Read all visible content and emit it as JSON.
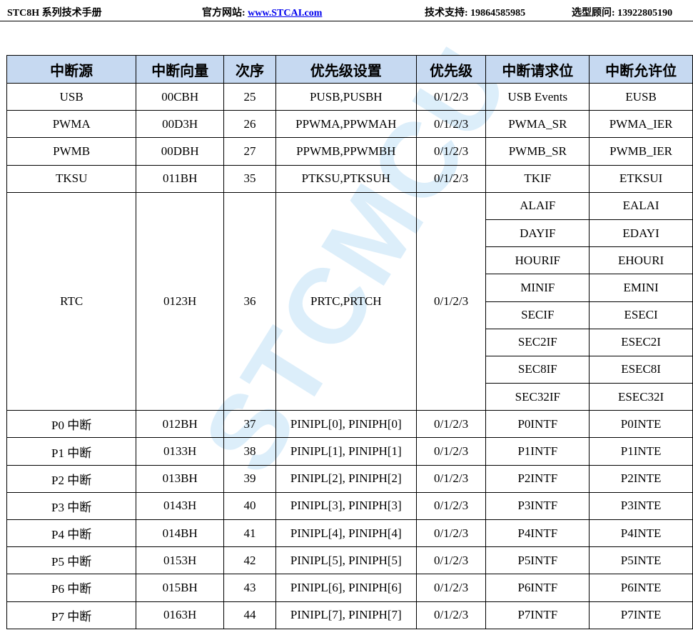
{
  "header": {
    "manual": "STC8H 系列技术手册",
    "site_label": "官方网站: ",
    "site_url": "www.STCAI.com",
    "support": "技术支持: 19864585985",
    "advisor": "选型顾问: 13922805190"
  },
  "watermark": "STCMCU",
  "table": {
    "headers": [
      "中断源",
      "中断向量",
      "次序",
      "优先级设置",
      "优先级",
      "中断请求位",
      "中断允许位"
    ],
    "rows": [
      {
        "src": "USB",
        "vec": "00CBH",
        "ord": "25",
        "set": "PUSB,PUSBH",
        "pri": "0/1/2/3",
        "req": "USB Events",
        "en": "EUSB"
      },
      {
        "src": "PWMA",
        "vec": "00D3H",
        "ord": "26",
        "set": "PPWMA,PPWMAH",
        "pri": "0/1/2/3",
        "req": "PWMA_SR",
        "en": "PWMA_IER"
      },
      {
        "src": "PWMB",
        "vec": "00DBH",
        "ord": "27",
        "set": "PPWMB,PPWMBH",
        "pri": "0/1/2/3",
        "req": "PWMB_SR",
        "en": "PWMB_IER"
      },
      {
        "src": "TKSU",
        "vec": "011BH",
        "ord": "35",
        "set": "PTKSU,PTKSUH",
        "pri": "0/1/2/3",
        "req": "TKIF",
        "en": "ETKSUI"
      }
    ],
    "rtc": {
      "src": "RTC",
      "vec": "0123H",
      "ord": "36",
      "set": "PRTC,PRTCH",
      "pri": "0/1/2/3",
      "flags": [
        {
          "req": "ALAIF",
          "en": "EALAI"
        },
        {
          "req": "DAYIF",
          "en": "EDAYI"
        },
        {
          "req": "HOURIF",
          "en": "EHOURI"
        },
        {
          "req": "MINIF",
          "en": "EMINI"
        },
        {
          "req": "SECIF",
          "en": "ESECI"
        },
        {
          "req": "SEC2IF",
          "en": "ESEC2I"
        },
        {
          "req": "SEC8IF",
          "en": "ESEC8I"
        },
        {
          "req": "SEC32IF",
          "en": "ESEC32I"
        }
      ]
    },
    "port_rows": [
      {
        "src": "P0 中断",
        "vec": "012BH",
        "ord": "37",
        "set": "PINIPL[0], PINIPH[0]",
        "pri": "0/1/2/3",
        "req": "P0INTF",
        "en": "P0INTE"
      },
      {
        "src": "P1 中断",
        "vec": "0133H",
        "ord": "38",
        "set": "PINIPL[1], PINIPH[1]",
        "pri": "0/1/2/3",
        "req": "P1INTF",
        "en": "P1INTE"
      },
      {
        "src": "P2 中断",
        "vec": "013BH",
        "ord": "39",
        "set": "PINIPL[2], PINIPH[2]",
        "pri": "0/1/2/3",
        "req": "P2INTF",
        "en": "P2INTE"
      },
      {
        "src": "P3 中断",
        "vec": "0143H",
        "ord": "40",
        "set": "PINIPL[3], PINIPH[3]",
        "pri": "0/1/2/3",
        "req": "P3INTF",
        "en": "P3INTE"
      },
      {
        "src": "P4 中断",
        "vec": "014BH",
        "ord": "41",
        "set": "PINIPL[4], PINIPH[4]",
        "pri": "0/1/2/3",
        "req": "P4INTF",
        "en": "P4INTE"
      },
      {
        "src": "P5 中断",
        "vec": "0153H",
        "ord": "42",
        "set": "PINIPL[5], PINIPH[5]",
        "pri": "0/1/2/3",
        "req": "P5INTF",
        "en": "P5INTE"
      },
      {
        "src": "P6 中断",
        "vec": "015BH",
        "ord": "43",
        "set": "PINIPL[6], PINIPH[6]",
        "pri": "0/1/2/3",
        "req": "P6INTF",
        "en": "P6INTE"
      },
      {
        "src": "P7 中断",
        "vec": "0163H",
        "ord": "44",
        "set": "PINIPL[7], PINIPH[7]",
        "pri": "0/1/2/3",
        "req": "P7INTF",
        "en": "P7INTE"
      }
    ]
  }
}
